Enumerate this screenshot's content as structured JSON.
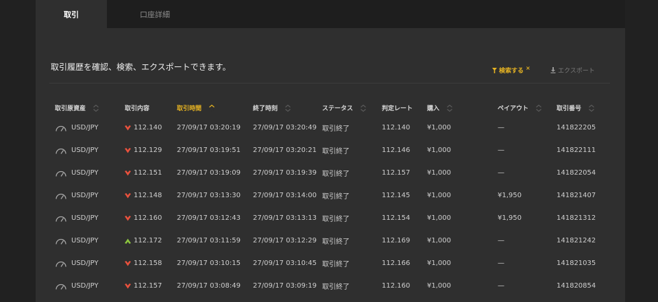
{
  "tabs": [
    {
      "label": "取引",
      "active": true
    },
    {
      "label": "口座詳細",
      "active": false
    }
  ],
  "intro_text": "取引履歴を確認、検索、エクスポートできます。",
  "actions": {
    "search_label": "検索する",
    "export_label": "エクスポート"
  },
  "colors": {
    "accent": "#e6b322",
    "down": "#e8513d",
    "up": "#8cc63e"
  },
  "table": {
    "columns": [
      {
        "label": "取引原資産",
        "sortable": true,
        "sorted": false
      },
      {
        "label": "取引内容",
        "sortable": false,
        "sorted": false
      },
      {
        "label": "取引時間",
        "sortable": true,
        "sorted": true
      },
      {
        "label": "終了時刻",
        "sortable": true,
        "sorted": false
      },
      {
        "label": "ステータス",
        "sortable": true,
        "sorted": false
      },
      {
        "label": "判定レート",
        "sortable": false,
        "sorted": false
      },
      {
        "label": "購入",
        "sortable": true,
        "sorted": false
      },
      {
        "label": "ペイアウト",
        "sortable": true,
        "sorted": false
      },
      {
        "label": "取引番号",
        "sortable": true,
        "sorted": false
      }
    ],
    "rows": [
      {
        "asset": "USD/JPY",
        "direction": "down",
        "rate": "112.140",
        "start": "27/09/17 03:20:19",
        "end": "27/09/17 03:20:49",
        "status": "取引終了",
        "judge": "112.140",
        "purchase": "¥1,000",
        "payout": "—",
        "number": "141822205"
      },
      {
        "asset": "USD/JPY",
        "direction": "down",
        "rate": "112.129",
        "start": "27/09/17 03:19:51",
        "end": "27/09/17 03:20:21",
        "status": "取引終了",
        "judge": "112.146",
        "purchase": "¥1,000",
        "payout": "—",
        "number": "141822111"
      },
      {
        "asset": "USD/JPY",
        "direction": "down",
        "rate": "112.151",
        "start": "27/09/17 03:19:09",
        "end": "27/09/17 03:19:39",
        "status": "取引終了",
        "judge": "112.157",
        "purchase": "¥1,000",
        "payout": "—",
        "number": "141822054"
      },
      {
        "asset": "USD/JPY",
        "direction": "down",
        "rate": "112.148",
        "start": "27/09/17 03:13:30",
        "end": "27/09/17 03:14:00",
        "status": "取引終了",
        "judge": "112.145",
        "purchase": "¥1,000",
        "payout": "¥1,950",
        "number": "141821407"
      },
      {
        "asset": "USD/JPY",
        "direction": "down",
        "rate": "112.160",
        "start": "27/09/17 03:12:43",
        "end": "27/09/17 03:13:13",
        "status": "取引終了",
        "judge": "112.154",
        "purchase": "¥1,000",
        "payout": "¥1,950",
        "number": "141821312"
      },
      {
        "asset": "USD/JPY",
        "direction": "up",
        "rate": "112.172",
        "start": "27/09/17 03:11:59",
        "end": "27/09/17 03:12:29",
        "status": "取引終了",
        "judge": "112.169",
        "purchase": "¥1,000",
        "payout": "—",
        "number": "141821242"
      },
      {
        "asset": "USD/JPY",
        "direction": "down",
        "rate": "112.158",
        "start": "27/09/17 03:10:15",
        "end": "27/09/17 03:10:45",
        "status": "取引終了",
        "judge": "112.166",
        "purchase": "¥1,000",
        "payout": "—",
        "number": "141821035"
      },
      {
        "asset": "USD/JPY",
        "direction": "down",
        "rate": "112.157",
        "start": "27/09/17 03:08:49",
        "end": "27/09/17 03:09:19",
        "status": "取引終了",
        "judge": "112.160",
        "purchase": "¥1,000",
        "payout": "—",
        "number": "141820854"
      }
    ]
  }
}
